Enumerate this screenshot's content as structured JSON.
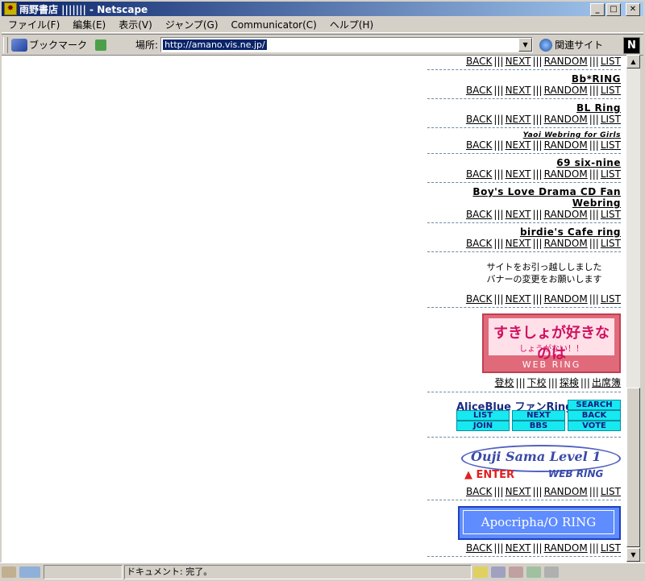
{
  "window": {
    "title": "雨野書店 ||||||| - Netscape",
    "title_icon": "netscape-star-icon"
  },
  "menu": [
    "ファイル(F)",
    "編集(E)",
    "表示(V)",
    "ジャンプ(G)",
    "Communicator(C)",
    "ヘルプ(H)"
  ],
  "toolbar": {
    "bookmark_label": "ブックマーク",
    "location_label": "場所:",
    "url": "http://amano.vis.ne.jp/",
    "related_label": "関連サイト",
    "logo_letter": "N"
  },
  "nav": {
    "back": "BACK",
    "next": "NEXT",
    "random": "RANDOM",
    "list": "LIST",
    "sep": "|||"
  },
  "rings": [
    {
      "title": ""
    },
    {
      "title": "Bb*RING"
    },
    {
      "title": "BL Ring"
    },
    {
      "title": "Yaoi Webring for Girls"
    },
    {
      "title": "69 six-nine"
    },
    {
      "title": "Boy's Love Drama CD Fan Webring"
    },
    {
      "title": "birdie's Cafe ring"
    }
  ],
  "notice": {
    "line1": "サイトをお引っ越ししました",
    "line2": "バナーの変更をお願いします"
  },
  "suki": {
    "main": "すきしょが好きなのは",
    "sub": "しょうがない！！",
    "ring": "WEB RING",
    "links": [
      "登校",
      "下校",
      "探検",
      "出席簿"
    ]
  },
  "alice": {
    "title": "AliceBlue ファンRing",
    "buttons": [
      "SEARCH",
      "LIST",
      "NEXT",
      "BACK",
      "JOIN",
      "BBS",
      "VOTE"
    ]
  },
  "ouji": {
    "title": "Ouji Sama Level 1",
    "enter": "▲ ENTER",
    "ring": "WEB RING"
  },
  "apoc": {
    "title": "Apocripha/O RING"
  },
  "status": {
    "text": "ドキュメント: 完了。"
  }
}
